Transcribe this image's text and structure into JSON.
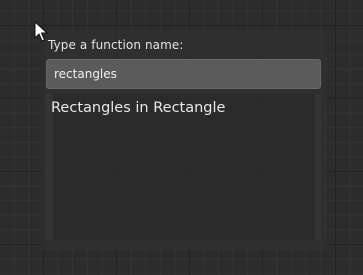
{
  "finder": {
    "prompt": "Type a function name:",
    "search_value": "rectangles",
    "results": [
      {
        "label": "Rectangles in Rectangle"
      }
    ]
  },
  "colors": {
    "canvas_bg": "#2c2c2c",
    "input_bg": "#5b5b5b",
    "text": "#e4e4e4"
  },
  "icons": {
    "cursor": "mouse-pointer-icon"
  }
}
